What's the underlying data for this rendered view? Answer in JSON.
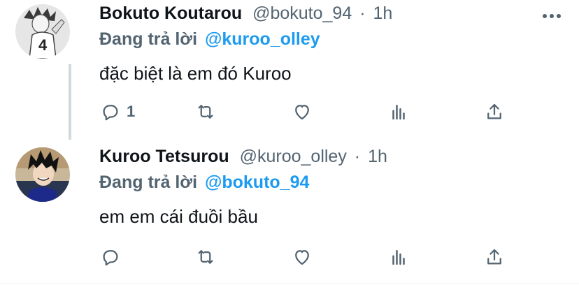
{
  "tweet1": {
    "name": "Bokuto Koutarou",
    "handle": "@bokuto_94",
    "dot": "·",
    "time": "1h",
    "reply_prefix": "Đang trả lời",
    "reply_to": "@kuroo_olley",
    "text": "đặc biệt là em đó Kuroo",
    "reply_count": "1"
  },
  "tweet2": {
    "name": "Kuroo Tetsurou",
    "handle": "@kuroo_olley",
    "dot": "·",
    "time": "1h",
    "reply_prefix": "Đang trả lời",
    "reply_to": "@bokuto_94",
    "text": "em em cái đuồi bầu"
  },
  "icons": {
    "reply": "reply-icon",
    "retweet": "retweet-icon",
    "like": "heart-icon",
    "analytics": "analytics-icon",
    "share": "share-icon",
    "more": "more-icon"
  },
  "colors": {
    "link": "#1d9bf0",
    "secondary": "#536471",
    "thread_line": "#cfd9de"
  }
}
